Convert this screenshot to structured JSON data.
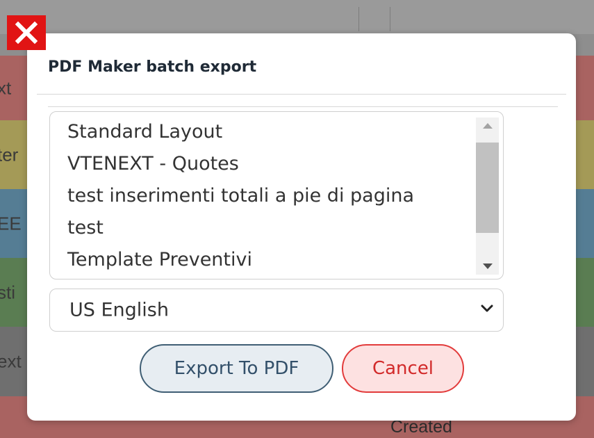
{
  "background": {
    "rows": [
      {
        "text": "xt"
      },
      {
        "text": "ter"
      },
      {
        "text": "EE"
      },
      {
        "text": "sti"
      },
      {
        "text": "ext"
      },
      {
        "text": ""
      }
    ],
    "footer_text": "Created"
  },
  "modal": {
    "title": "PDF Maker batch export",
    "templates": [
      "Standard Layout",
      "VTENEXT - Quotes",
      "test inserimenti totali a pie di pagina",
      "test",
      "Template Preventivi"
    ],
    "language": {
      "selected": "US English"
    },
    "buttons": {
      "export_label": "Export To PDF",
      "cancel_label": "Cancel"
    }
  },
  "icons": {
    "close": "close-icon",
    "scroll_up": "caret-up-icon",
    "scroll_down": "caret-down-icon",
    "select": "chevron-down-icon"
  },
  "colors": {
    "close_box": "#e11414",
    "export_border": "#3f5e74",
    "cancel_border": "#e23b3b",
    "cancel_text": "#d22a2a"
  }
}
